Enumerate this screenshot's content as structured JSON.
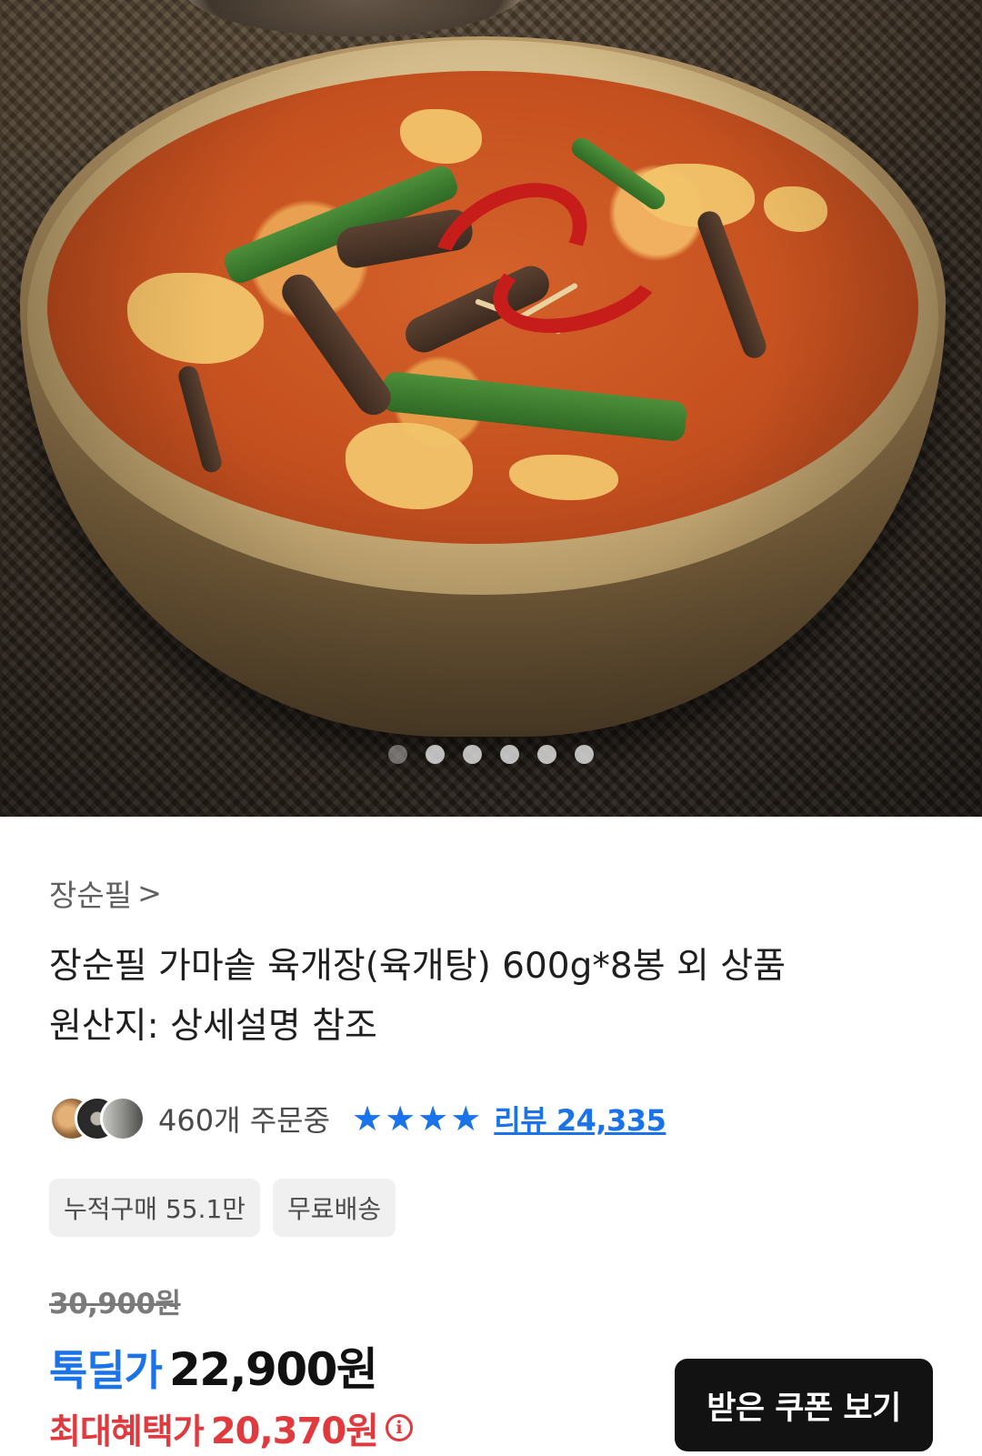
{
  "hero": {
    "image_icon": "yukgaejang-bowl-photo",
    "carousel": {
      "total": 6,
      "active_index": 0
    }
  },
  "product": {
    "brand": "장순필",
    "brand_chevron": ">",
    "title_line1": "장순필 가마솥 육개장(육개탕) 600g*8봉 외 상품",
    "title_line2": "원산지: 상세설명 참조",
    "orders_text": "460개 주문중",
    "rating_stars": 4,
    "star_glyph": "★",
    "reviews_text": "리뷰 24,335",
    "chips": [
      "누적구매 55.1만",
      "무료배송"
    ],
    "original_price": "30,900원",
    "deal_label": "톡딜가",
    "deal_price": "22,900원",
    "max_benefit_label": "최대혜택가",
    "max_benefit_price": "20,370원",
    "info_glyph": "i",
    "coupon_button": "받은 쿠폰 보기"
  },
  "colors": {
    "accent_blue": "#1a73e8",
    "benefit_red": "#e0393e",
    "button_dark": "#121212"
  }
}
